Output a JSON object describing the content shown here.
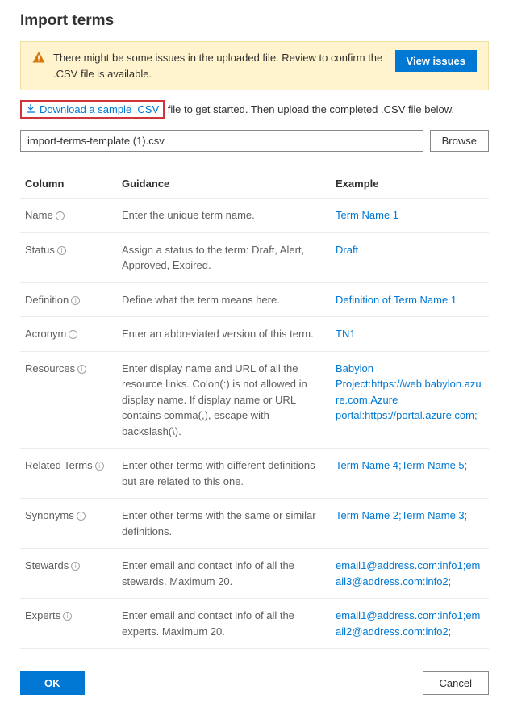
{
  "title": "Import terms",
  "warning": {
    "text": "There might be some issues in the uploaded file. Review to confirm the .CSV file is available.",
    "button": "View issues"
  },
  "download": {
    "link_text": "Download a sample .CSV",
    "rest_text": " file to get started. Then upload the completed .CSV file below."
  },
  "file": {
    "value": "import-terms-template (1).csv",
    "browse": "Browse"
  },
  "table": {
    "headers": {
      "column": "Column",
      "guidance": "Guidance",
      "example": "Example"
    },
    "rows": [
      {
        "column": "Name",
        "guidance": "Enter the unique term name.",
        "example": "Term Name 1"
      },
      {
        "column": "Status",
        "guidance": "Assign a status to the term: Draft, Alert, Approved, Expired.",
        "example": "Draft"
      },
      {
        "column": "Definition",
        "guidance": "Define what the term means here.",
        "example": "Definition of Term Name 1"
      },
      {
        "column": "Acronym",
        "guidance": "Enter an abbreviated version of this term.",
        "example": "TN1"
      },
      {
        "column": "Resources",
        "guidance": "Enter display name and URL of all the resource links. Colon(:) is not allowed in display name. If display name or URL contains comma(,), escape with backslash(\\).",
        "example": "Babylon Project:https://web.babylon.azure.com;Azure portal:https://portal.azure.com;"
      },
      {
        "column": "Related Terms",
        "guidance": "Enter other terms with different definitions but are related to this one.",
        "example": "Term Name 4;Term Name 5;"
      },
      {
        "column": "Synonyms",
        "guidance": "Enter other terms with the same or similar definitions.",
        "example": "Term Name 2;Term Name 3;"
      },
      {
        "column": "Stewards",
        "guidance": "Enter email and contact info of all the stewards. Maximum 20.",
        "example": "email1@address.com:info1;email3@address.com:info2;"
      },
      {
        "column": "Experts",
        "guidance": "Enter email and contact info of all the experts. Maximum 20.",
        "example": "email1@address.com:info1;email2@address.com:info2;"
      }
    ]
  },
  "footer": {
    "ok": "OK",
    "cancel": "Cancel"
  }
}
